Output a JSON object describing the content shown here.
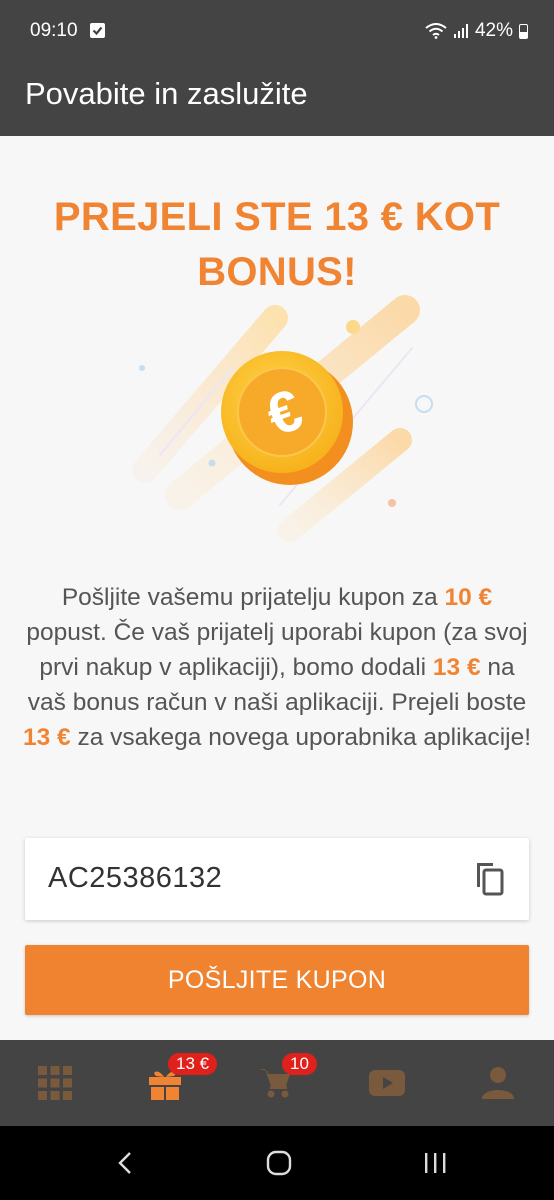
{
  "status_bar": {
    "time": "09:10",
    "battery": "42%"
  },
  "app_bar": {
    "title": "Povabite in zaslužite"
  },
  "headline": {
    "line1": "PREJELI STE 13 € KOT",
    "line2": "BONUS!"
  },
  "description": {
    "p1": "Pošljite vašemu prijatelju kupon za ",
    "hl1": "10 €",
    "p2": " popust. Če vaš prijatelj uporabi kupon (za svoj prvi nakup v aplikaciji), bomo dodali ",
    "hl2": "13 €",
    "p3": " na vaš bonus račun v naši aplikaciji. Prejeli boste ",
    "hl3": "13 €",
    "p4": " za vsakega novega uporabnika aplikacije!"
  },
  "coupon": {
    "code": "AC25386132"
  },
  "send_button": {
    "label": "POŠLJITE KUPON"
  },
  "bottom_nav": {
    "gift_badge": "13 €",
    "cart_badge": "10"
  },
  "colors": {
    "accent": "#f08432",
    "bar": "#444444",
    "badge": "#e0201b",
    "nav_icon": "#7a5a3c"
  }
}
